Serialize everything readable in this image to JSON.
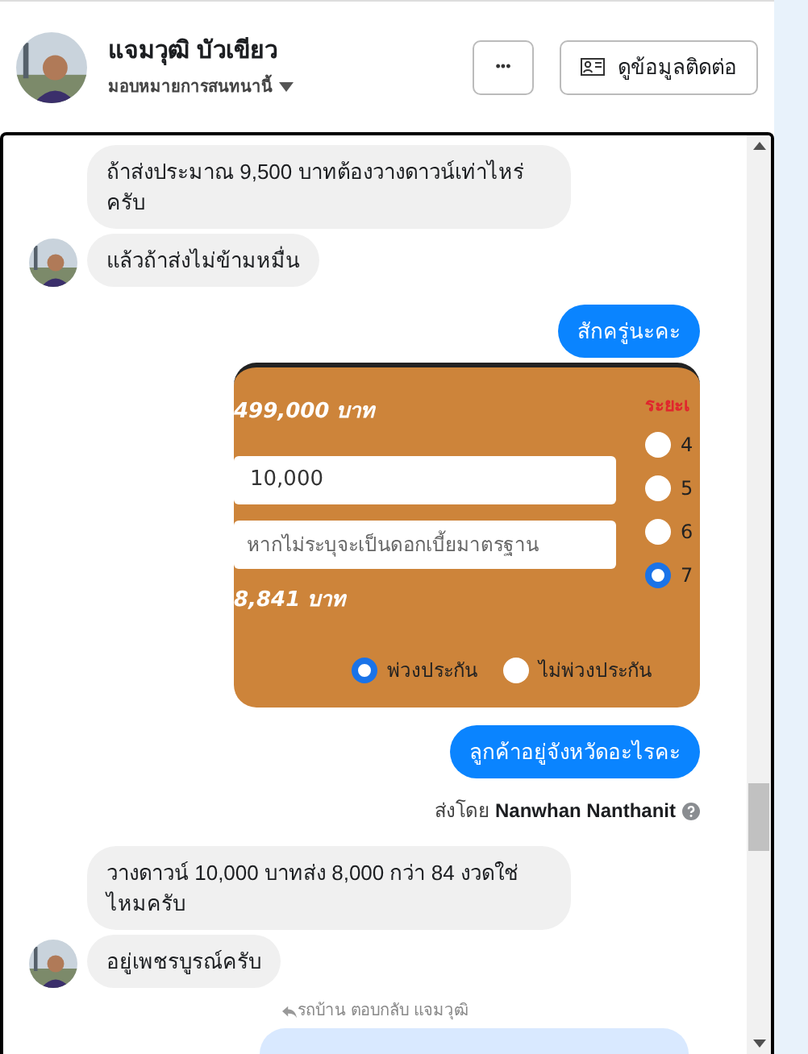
{
  "header": {
    "name": "แจมวุฒิ บัวเขียว",
    "assign": "มอบหมายการสนทนานี้",
    "more_button": "•••",
    "contact_button": "ดูข้อมูลติดต่อ"
  },
  "messages": [
    {
      "kind": "incoming",
      "text": "ถ้าส่งประมาณ 9,500 บาทต้องวางดาวน์เท่าไหร่ครับ",
      "show_avatar": false
    },
    {
      "kind": "incoming",
      "text": "แล้วถ้าส่งไม่ข้ามหมื่น",
      "show_avatar": true
    },
    {
      "kind": "outgoing",
      "text": "สักครู่นะคะ"
    },
    {
      "kind": "attachment",
      "price": "499,000 บาท",
      "term_label": "ระยะเ",
      "down_field": "10,000",
      "rate_placeholder": "หากไม่ระบุจะเป็นดอกเบี้ยมาตรฐาน",
      "result": "8,841 บาท",
      "terms": [
        {
          "label": "4",
          "selected": false
        },
        {
          "label": "5",
          "selected": false
        },
        {
          "label": "6",
          "selected": false
        },
        {
          "label": "7",
          "selected": true
        }
      ],
      "insurance": [
        {
          "label": "พ่วงประกัน",
          "selected": true
        },
        {
          "label": "ไม่พ่วงประกัน",
          "selected": false
        }
      ]
    },
    {
      "kind": "outgoing",
      "text": "ลูกค้าอยู่จังหวัดอะไรคะ"
    },
    {
      "kind": "sender_note",
      "prefix": "ส่งโดย",
      "sender": "Nanwhan Nanthanit"
    },
    {
      "kind": "incoming",
      "text": "วางดาวน์ 10,000 บาทส่ง 8,000 กว่า 84 งวดใช่ไหมครับ",
      "show_avatar": false
    },
    {
      "kind": "incoming",
      "text": "อยู่เพชรบูรณ์ครับ",
      "show_avatar": true
    },
    {
      "kind": "reply_note",
      "text": "รถบ้าน ตอบกลับ แจมวุฒิ"
    },
    {
      "kind": "reply_bubble"
    }
  ]
}
